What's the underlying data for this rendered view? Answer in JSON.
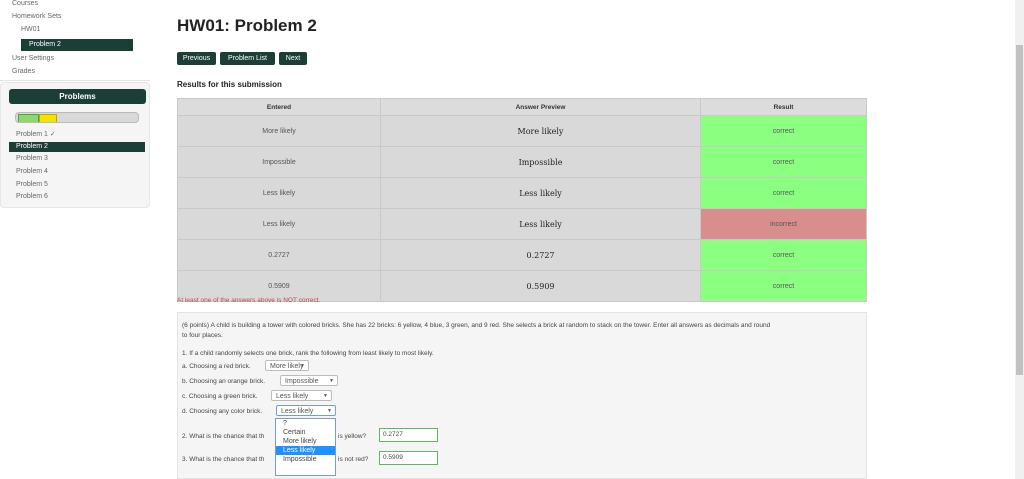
{
  "nav": {
    "courses": "Courses",
    "homework_sets": "Homework Sets",
    "hw01": "HW01",
    "problem2": "Problem 2",
    "user_settings": "User Settings",
    "grades": "Grades"
  },
  "problems_panel": {
    "title": "Problems",
    "items": [
      "Problem 1 ✓",
      "Problem 2",
      "Problem 3",
      "Problem 4",
      "Problem 5",
      "Problem 6"
    ],
    "progress": {
      "correct_fraction": 0.15,
      "partial_fraction": 0.13
    }
  },
  "page": {
    "title": "HW01: Problem 2",
    "buttons": {
      "previous": "Previous",
      "problem_list": "Problem List",
      "next": "Next"
    }
  },
  "results": {
    "title": "Results for this submission",
    "headers": [
      "Entered",
      "Answer Preview",
      "Result"
    ],
    "rows": [
      {
        "entered": "More likely",
        "preview": "More likely",
        "result": "correct"
      },
      {
        "entered": "Impossible",
        "preview": "Impossible",
        "result": "correct"
      },
      {
        "entered": "Less likely",
        "preview": "Less likely",
        "result": "correct"
      },
      {
        "entered": "Less likely",
        "preview": "Less likely",
        "result": "incorrect"
      },
      {
        "entered": "0.2727",
        "preview": "0.2727",
        "result": "correct"
      },
      {
        "entered": "0.5909",
        "preview": "0.5909",
        "result": "correct"
      }
    ],
    "warning": "At least one of the answers above is NOT correct."
  },
  "problem": {
    "statement": "(6 points) A child is building a tower with colored bricks. She has 22 bricks: 6 yellow, 4 blue, 3 green, and 9 red. She selects a brick at random to stack on the tower. Enter all answers as decimals and round",
    "statement2": "to four places.",
    "q1": "1. If a child randomly selects one brick, rank the following from least likely to most likely.",
    "q1a": "a. Choosing a red brick.",
    "q1a_val": "More likely",
    "q1b": "b. Choosing an orange brick.",
    "q1b_val": "Impossible",
    "q1c": "c. Choosing a green brick.",
    "q1c_val": "Less likely",
    "q1d": "d. Choosing any color brick.",
    "q1d_val": "Less likely",
    "q2_pre": "2. What is the chance that th",
    "q2_post": "is yellow?",
    "q2_val": "0.2727",
    "q3_pre": "3. What is the chance that th",
    "q3_post": "is not red?",
    "q3_val": "0.5909",
    "dropdown_options": [
      "?",
      "Certain",
      "More likely",
      "Less likely",
      "Impossible"
    ]
  },
  "colors": {
    "dark_green": "#1b3f37",
    "correct": "#8bff80",
    "incorrect": "#d98e8e"
  }
}
